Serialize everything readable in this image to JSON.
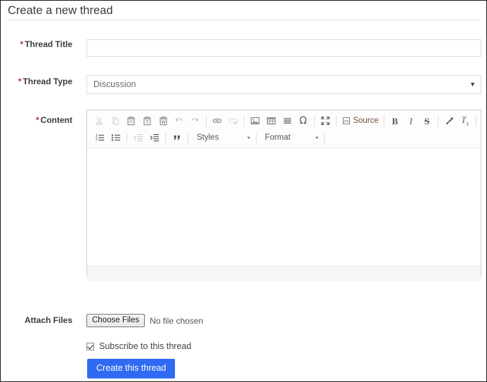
{
  "page": {
    "title": "Create a new thread"
  },
  "fields": {
    "thread_title": {
      "label": "Thread Title",
      "required_marker": "*",
      "value": "",
      "placeholder": ""
    },
    "thread_type": {
      "label": "Thread Type",
      "required_marker": "*",
      "selected": "Discussion",
      "caret": "▼"
    },
    "content": {
      "label": "Content",
      "required_marker": "*",
      "value": ""
    },
    "attach_files": {
      "label": "Attach Files",
      "button_label": "Choose Files",
      "status_text": "No file chosen"
    },
    "subscribe": {
      "label": "Subscribe to this thread",
      "checked": true
    }
  },
  "editor": {
    "toolbar_row1": [
      {
        "name": "cut-icon",
        "title": "Cut",
        "dim": true
      },
      {
        "name": "copy-icon",
        "title": "Copy",
        "dim": true
      },
      {
        "name": "paste-icon",
        "title": "Paste",
        "dim": false
      },
      {
        "name": "paste-text-icon",
        "title": "Paste as plain text",
        "dim": false
      },
      {
        "name": "paste-word-icon",
        "title": "Paste from Word",
        "dim": false
      },
      {
        "name": "undo-icon",
        "title": "Undo",
        "dim": true
      },
      {
        "name": "redo-icon",
        "title": "Redo",
        "dim": true
      },
      {
        "name": "separator",
        "title": "",
        "dim": false
      },
      {
        "name": "link-icon",
        "title": "Link",
        "dim": false
      },
      {
        "name": "unlink-icon",
        "title": "Unlink",
        "dim": true
      },
      {
        "name": "separator",
        "title": "",
        "dim": false
      },
      {
        "name": "image-icon",
        "title": "Image",
        "dim": false
      },
      {
        "name": "table-icon",
        "title": "Table",
        "dim": false
      },
      {
        "name": "horizontal-rule-icon",
        "title": "Horizontal Line",
        "dim": false
      },
      {
        "name": "special-character-icon",
        "title": "Insert Special Character",
        "dim": false
      },
      {
        "name": "separator",
        "title": "",
        "dim": false
      },
      {
        "name": "maximize-icon",
        "title": "Maximize",
        "dim": false
      },
      {
        "name": "separator",
        "title": "",
        "dim": false
      },
      {
        "name": "source-button",
        "title": "Source",
        "dim": false
      },
      {
        "name": "separator",
        "title": "",
        "dim": false
      },
      {
        "name": "bold-icon",
        "title": "Bold",
        "dim": false
      },
      {
        "name": "italic-icon",
        "title": "Italic",
        "dim": false
      },
      {
        "name": "strikethrough-icon",
        "title": "Strikethrough",
        "dim": false
      },
      {
        "name": "separator",
        "title": "",
        "dim": false
      },
      {
        "name": "remove-format-icon",
        "title": "Remove Format",
        "dim": false
      },
      {
        "name": "remove-text-style-icon",
        "title": "Remove text styling",
        "dim": false
      },
      {
        "name": "separator",
        "title": "",
        "dim": false
      }
    ],
    "source_label": "Source",
    "toolbar_row2": [
      {
        "name": "numbered-list-icon",
        "title": "Insert/Remove Numbered List",
        "dim": false
      },
      {
        "name": "bulleted-list-icon",
        "title": "Insert/Remove Bulleted List",
        "dim": false
      },
      {
        "name": "separator",
        "title": "",
        "dim": false
      },
      {
        "name": "outdent-icon",
        "title": "Decrease Indent",
        "dim": true
      },
      {
        "name": "indent-icon",
        "title": "Increase Indent",
        "dim": false
      },
      {
        "name": "separator",
        "title": "",
        "dim": false
      },
      {
        "name": "blockquote-icon",
        "title": "Block Quote",
        "dim": false
      },
      {
        "name": "separator",
        "title": "",
        "dim": false
      }
    ],
    "styles_combo": {
      "label": "Styles",
      "caret": "▾"
    },
    "format_combo": {
      "label": "Format",
      "caret": "▾"
    }
  },
  "actions": {
    "submit_label": "Create this thread"
  },
  "colors": {
    "accent_blue": "#2e6bf2",
    "required_red": "#b03030",
    "border_gray": "#dcdcdc",
    "toolbar_bg": "#fdfdfd",
    "footer_bg": "#f6f6f6"
  }
}
